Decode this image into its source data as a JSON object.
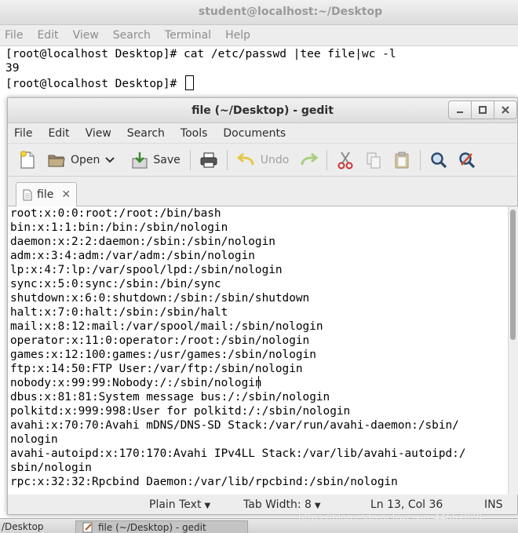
{
  "terminal": {
    "title": "student@localhost:~/Desktop",
    "menu": [
      "File",
      "Edit",
      "View",
      "Search",
      "Terminal",
      "Help"
    ],
    "lines": [
      "[root@localhost Desktop]# cat /etc/passwd |tee file|wc -l",
      "39",
      "[root@localhost Desktop]# "
    ]
  },
  "gedit": {
    "title": "file (~/Desktop) - gedit",
    "menu": [
      "File",
      "Edit",
      "View",
      "Search",
      "Tools",
      "Documents"
    ],
    "toolbar": {
      "open_label": "Open",
      "save_label": "Save",
      "undo_label": "Undo"
    },
    "tab": {
      "label": "file"
    },
    "content_lines": [
      "root:x:0:0:root:/root:/bin/bash",
      "bin:x:1:1:bin:/bin:/sbin/nologin",
      "daemon:x:2:2:daemon:/sbin:/sbin/nologin",
      "adm:x:3:4:adm:/var/adm:/sbin/nologin",
      "lp:x:4:7:lp:/var/spool/lpd:/sbin/nologin",
      "sync:x:5:0:sync:/sbin:/bin/sync",
      "shutdown:x:6:0:shutdown:/sbin:/sbin/shutdown",
      "halt:x:7:0:halt:/sbin:/sbin/halt",
      "mail:x:8:12:mail:/var/spool/mail:/sbin/nologin",
      "operator:x:11:0:operator:/root:/sbin/nologin",
      "games:x:12:100:games:/usr/games:/sbin/nologin",
      "ftp:x:14:50:FTP User:/var/ftp:/sbin/nologin",
      "nobody:x:99:99:Nobody:/:/sbin/nologin",
      "dbus:x:81:81:System message bus:/:/sbin/nologin",
      "polkitd:x:999:998:User for polkitd:/:/sbin/nologin",
      "avahi:x:70:70:Avahi mDNS/DNS-SD Stack:/var/run/avahi-daemon:/sbin/",
      "nologin",
      "avahi-autoipd:x:170:170:Avahi IPv4LL Stack:/var/lib/avahi-autoipd:/",
      "sbin/nologin",
      "rpc:x:32:32:Rpcbind Daemon:/var/lib/rpcbind:/sbin/nologin"
    ],
    "status": {
      "language": "Plain Text",
      "tab_width": "Tab Width: 8",
      "position": "Ln 13, Col 36",
      "mode": "INS"
    }
  },
  "taskbar": {
    "terminal_item": "/Desktop",
    "gedit_item": "file (~/Desktop) - gedit"
  },
  "watermark": "https://blog.csdn.net/weixin_44667020"
}
